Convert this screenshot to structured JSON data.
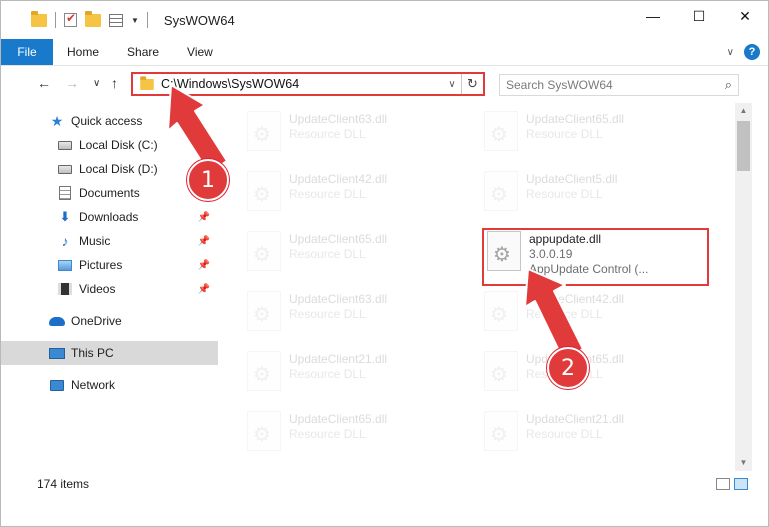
{
  "window": {
    "title": "SysWOW64",
    "controls": {
      "minimize": "—",
      "maximize": "☐",
      "close": "✕"
    }
  },
  "ribbon": {
    "tabs": [
      "File",
      "Home",
      "Share",
      "View"
    ],
    "help": "?",
    "expand": "∨"
  },
  "nav": {
    "back": "←",
    "forward": "→",
    "recent": "∨",
    "up": "↑"
  },
  "address": {
    "path": "C:\\Windows\\SysWOW64",
    "dropdown": "∨",
    "refresh": "↻"
  },
  "search": {
    "placeholder": "Search SysWOW64",
    "icon": "⌕"
  },
  "sidebar": {
    "items": [
      {
        "label": "Quick access",
        "icon": "star-icon"
      },
      {
        "label": "Local Disk (C:)",
        "icon": "drive-icon",
        "pinned": true
      },
      {
        "label": "Local Disk (D:)",
        "icon": "drive-icon"
      },
      {
        "label": "Documents",
        "icon": "documents-icon"
      },
      {
        "label": "Downloads",
        "icon": "downloads-icon",
        "pinned": true
      },
      {
        "label": "Music",
        "icon": "music-icon",
        "pinned": true
      },
      {
        "label": "Pictures",
        "icon": "pictures-icon",
        "pinned": true
      },
      {
        "label": "Videos",
        "icon": "videos-icon",
        "pinned": true
      },
      {
        "label": "OneDrive",
        "icon": "onedrive-icon"
      },
      {
        "label": "This PC",
        "icon": "pc-icon",
        "selected": true
      },
      {
        "label": "Network",
        "icon": "network-icon"
      }
    ],
    "pin_glyph": "📌"
  },
  "files": {
    "background": [
      {
        "name": "UpdateClient63.dll",
        "sub": "Resource DLL"
      },
      {
        "name": "UpdateClient65.dll",
        "sub": "Resource DLL"
      },
      {
        "name": "UpdateClient42.dll",
        "sub": "Resource DLL"
      },
      {
        "name": "UpdateClient5.dll",
        "sub": "Resource DLL"
      },
      {
        "name": "UpdateClient65.dll",
        "sub": "Resource DLL"
      },
      {
        "name": "UpdateClient63.dll",
        "sub": "Resource DLL"
      },
      {
        "name": "UpdateClient42.dll",
        "sub": "Resource DLL"
      },
      {
        "name": "UpdateClient21.dll",
        "sub": "Resource DLL"
      },
      {
        "name": "UpdateClient65.dll",
        "sub": "Resource DLL"
      },
      {
        "name": "UpdateClient65.dll",
        "sub": "Resource DLL"
      },
      {
        "name": "UpdateClient21.dll",
        "sub": "Resource DLL"
      }
    ],
    "highlighted": {
      "name": "appupdate.dll",
      "version": "3.0.0.19",
      "description": "AppUpdate Control (..."
    }
  },
  "status": {
    "count": "174 items"
  },
  "annotations": {
    "step1": "1",
    "step2": "2",
    "color": "#e03a3a"
  }
}
